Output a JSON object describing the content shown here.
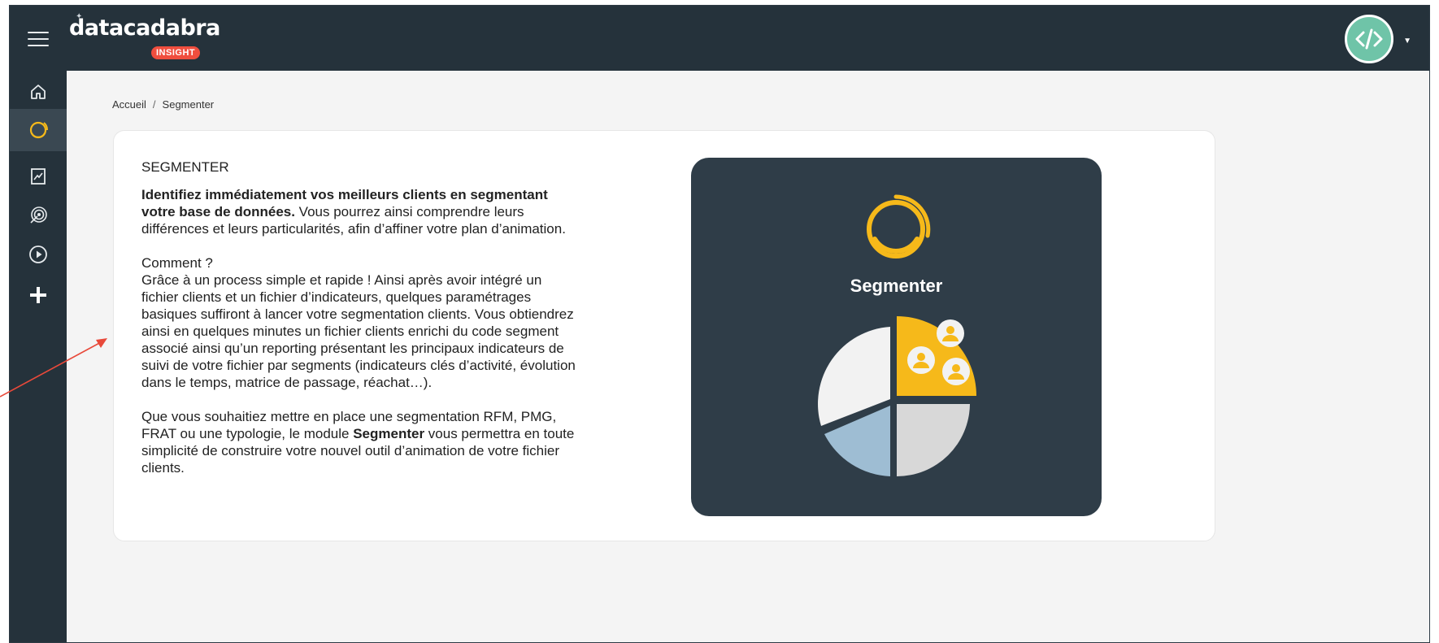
{
  "app": {
    "logo_text": "datacadabra",
    "logo_badge": "INSIGHT"
  },
  "breadcrumb": {
    "home": "Accueil",
    "separator": "/",
    "current": "Segmenter"
  },
  "card": {
    "title": "SEGMENTER",
    "intro_bold": "Identifiez immédiatement vos meilleurs clients en segmentant votre base de données.",
    "intro_rest": " Vous pourrez ainsi comprendre leurs différences et leurs particularités, afin d’affiner votre plan d’animation.",
    "how_title": "Comment ?",
    "how_text": "Grâce à un process simple et rapide ! Ainsi après avoir intégré un fichier clients et un fichier d’indicateurs, quelques paramétrages basiques suffiront à lancer votre segmentation clients. Vous obtiendrez ainsi en quelques minutes un fichier clients enrichi du code segment associé ainsi qu’un reporting présentant les principaux indicateurs de suivi de votre fichier par segments (indicateurs clés d’activité, évolution dans le temps, matrice de passage, réachat…).",
    "closing_start": "Que vous souhaitiez mettre en place une segmentation RFM, PMG, FRAT ou une typologie, le module ",
    "closing_bold": "Segmenter",
    "closing_end": " vous permettra en toute simplicité de construire votre nouvel outil d’animation de votre fichier clients."
  },
  "illustration": {
    "label": "Segmenter"
  },
  "sidebar": {
    "items": [
      {
        "icon": "home-icon",
        "active": false
      },
      {
        "icon": "segment-ring-icon",
        "active": true
      },
      {
        "icon": "report-chart-icon",
        "active": false
      },
      {
        "icon": "target-icon",
        "active": false
      },
      {
        "icon": "play-circle-icon",
        "active": false
      },
      {
        "icon": "plus-icon",
        "active": false
      }
    ]
  },
  "colors": {
    "topbar": "#25323b",
    "accent_yellow": "#f6b91a",
    "badge_red": "#f04e3e",
    "avatar_green": "#6fc4a8",
    "arrow_red": "#e8493a"
  }
}
